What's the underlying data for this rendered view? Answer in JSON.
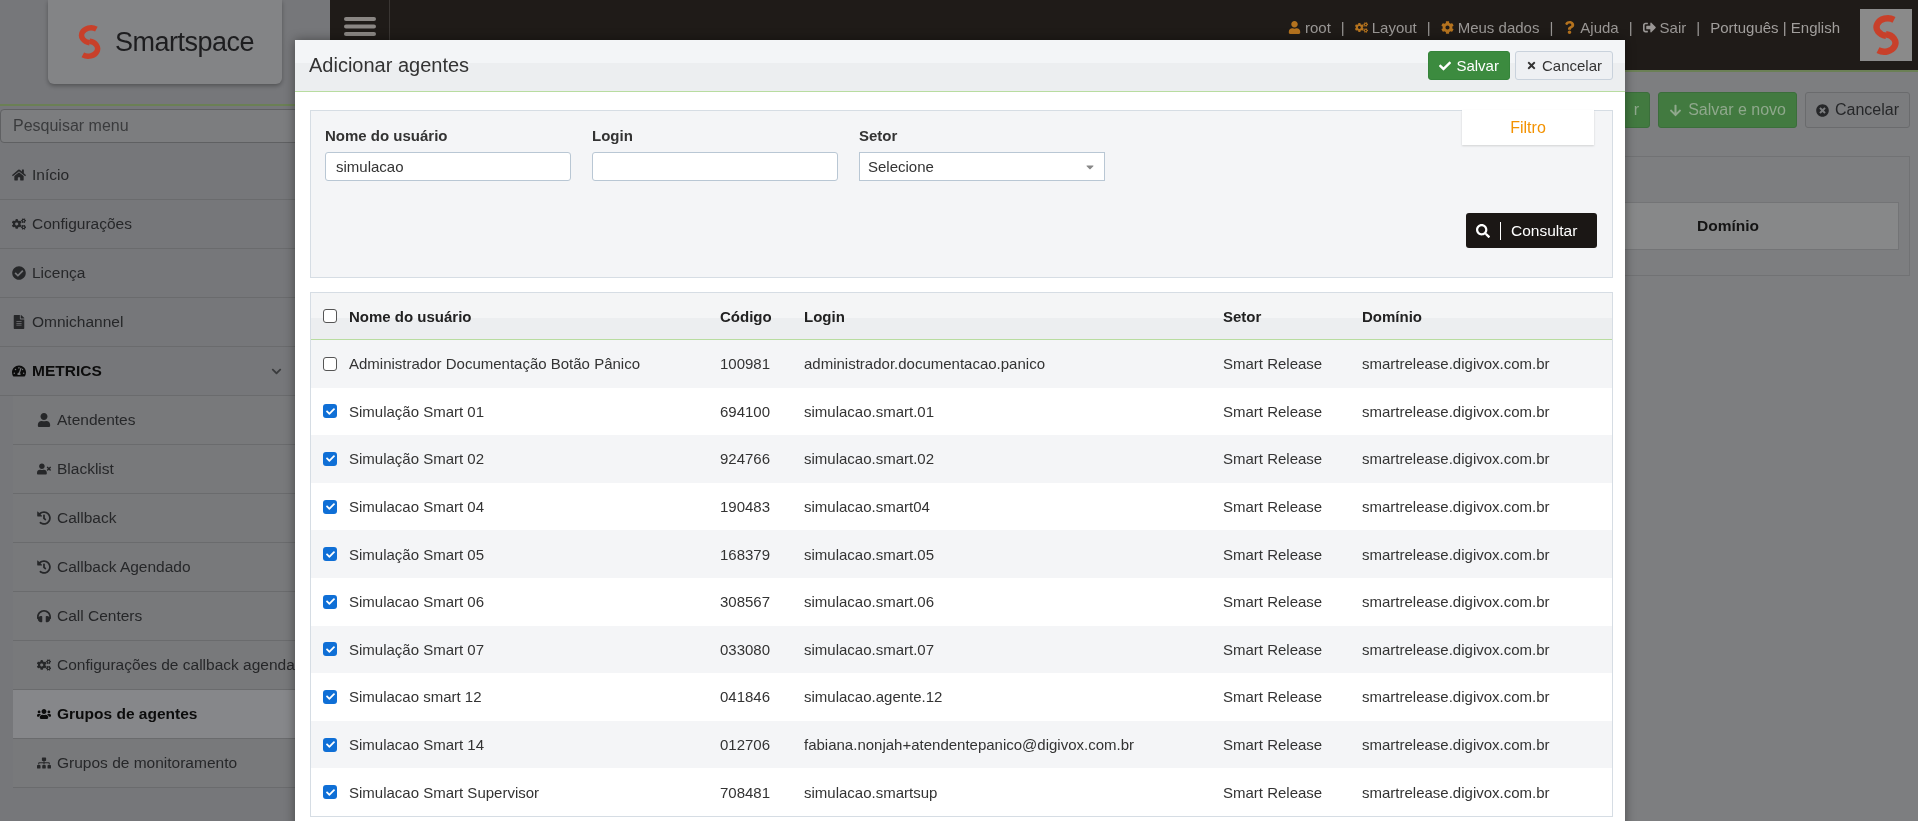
{
  "sidebar": {
    "logo_text": "Smartspace",
    "search": {
      "placeholder": "Pesquisar menu"
    },
    "items": [
      {
        "label": "Início",
        "selected": false
      },
      {
        "label": "Configurações",
        "selected": false
      },
      {
        "label": "Licença",
        "selected": false
      },
      {
        "label": "Omnichannel",
        "selected": false
      },
      {
        "label": "METRICS",
        "selected": false,
        "expanded": true,
        "children": [
          {
            "label": "Atendentes",
            "selected": false
          },
          {
            "label": "Blacklist",
            "selected": false
          },
          {
            "label": "Callback",
            "selected": false
          },
          {
            "label": "Callback Agendado",
            "selected": false
          },
          {
            "label": "Call Centers",
            "selected": false
          },
          {
            "label": "Configurações de callback agenda",
            "selected": false
          },
          {
            "label": "Grupos de agentes",
            "selected": true
          },
          {
            "label": "Grupos de monitoramento",
            "selected": false
          }
        ]
      }
    ]
  },
  "topbar": {
    "items": [
      {
        "kind": "link",
        "label": "root"
      },
      {
        "kind": "separator",
        "label": "|"
      },
      {
        "kind": "link",
        "label": "Layout"
      },
      {
        "kind": "separator",
        "label": "|"
      },
      {
        "kind": "link",
        "label": "Meus dados"
      },
      {
        "kind": "separator",
        "label": "|"
      },
      {
        "kind": "link",
        "label": "Ajuda"
      },
      {
        "kind": "separator",
        "label": "|"
      },
      {
        "kind": "link",
        "label": "Sair"
      },
      {
        "kind": "separator",
        "label": "|"
      },
      {
        "kind": "language",
        "label": "Português | English"
      }
    ]
  },
  "page_actions": [
    {
      "label": "r",
      "kind": "primary"
    },
    {
      "label": "Salvar e novo",
      "kind": "primary"
    },
    {
      "label": "Cancelar",
      "kind": "default"
    }
  ],
  "background_table": {
    "columns": [
      "Domínio"
    ]
  },
  "modal": {
    "title": "Adicionar agentes",
    "buttons": [
      {
        "label": "Salvar",
        "kind": "primary"
      },
      {
        "label": "Cancelar",
        "kind": "default"
      }
    ],
    "filter": {
      "tab": "Filtro",
      "fields": [
        {
          "label": "Nome do usuário",
          "kind": "text",
          "value": "simulacao"
        },
        {
          "label": "Login",
          "kind": "text"
        },
        {
          "label": "Setor",
          "kind": "select",
          "value": "Selecione"
        }
      ],
      "submit": "Consultar"
    },
    "table": {
      "select_all_checked": false,
      "columns": [
        "Nome do usuário",
        "Código",
        "Login",
        "Setor",
        "Domínio"
      ],
      "rows": [
        {
          "checked": false,
          "cells": [
            "Administrador Documentação Botão Pânico",
            "100981",
            "administrador.documentacao.panico",
            "Smart Release",
            "smartrelease.digivox.com.br"
          ]
        },
        {
          "checked": true,
          "cells": [
            "Simulação Smart 01",
            "694100",
            "simulacao.smart.01",
            "Smart Release",
            "smartrelease.digivox.com.br"
          ]
        },
        {
          "checked": true,
          "cells": [
            "Simulação Smart 02",
            "924766",
            "simulacao.smart.02",
            "Smart Release",
            "smartrelease.digivox.com.br"
          ]
        },
        {
          "checked": true,
          "cells": [
            "Simulacao Smart 04",
            "190483",
            "simulacao.smart04",
            "Smart Release",
            "smartrelease.digivox.com.br"
          ]
        },
        {
          "checked": true,
          "cells": [
            "Simulação Smart 05",
            "168379",
            "simulacao.smart.05",
            "Smart Release",
            "smartrelease.digivox.com.br"
          ]
        },
        {
          "checked": true,
          "cells": [
            "Simulacao Smart 06",
            "308567",
            "simulacao.smart.06",
            "Smart Release",
            "smartrelease.digivox.com.br"
          ]
        },
        {
          "checked": true,
          "cells": [
            "Simulação Smart 07",
            "033080",
            "simulacao.smart.07",
            "Smart Release",
            "smartrelease.digivox.com.br"
          ]
        },
        {
          "checked": true,
          "cells": [
            "Simulacao smart 12",
            "041846",
            "simulacao.agente.12",
            "Smart Release",
            "smartrelease.digivox.com.br"
          ]
        },
        {
          "checked": true,
          "cells": [
            "Simulacao Smart 14",
            "012706",
            "fabiana.nonjah+atendentepanico@digivox.com.br",
            "Smart Release",
            "smartrelease.digivox.com.br"
          ]
        },
        {
          "checked": true,
          "cells": [
            "Simulacao Smart Supervisor",
            "708481",
            "simulacao.smartsup",
            "Smart Release",
            "smartrelease.digivox.com.br"
          ]
        }
      ]
    }
  }
}
